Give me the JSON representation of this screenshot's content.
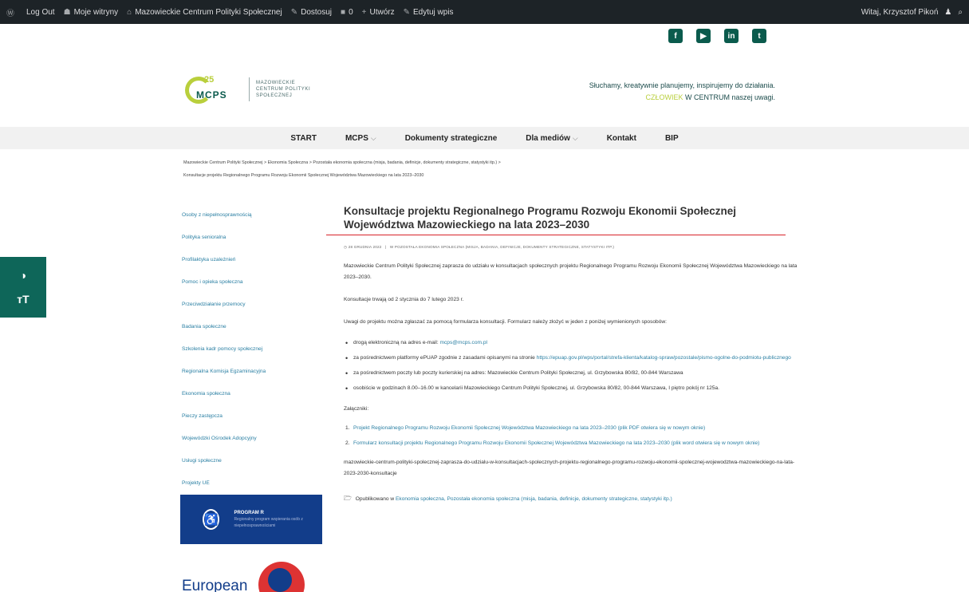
{
  "admin_bar": {
    "items": [
      {
        "icon": "wordpress-icon",
        "glyph": "Ⓦ",
        "label": ""
      },
      {
        "icon": "logout-icon",
        "glyph": "",
        "label": "Log Out"
      },
      {
        "icon": "network-icon",
        "glyph": "☗",
        "label": "Moje witryny"
      },
      {
        "icon": "home-icon",
        "glyph": "⌂",
        "label": "Mazowieckie Centrum Polityki Społecznej"
      },
      {
        "icon": "customize-icon",
        "glyph": "✎",
        "label": "Dostosuj"
      },
      {
        "icon": "comments-icon",
        "glyph": "■",
        "label": "0"
      },
      {
        "icon": "plus-icon",
        "glyph": "+",
        "label": "Utwórz"
      },
      {
        "icon": "edit-icon",
        "glyph": "✎",
        "label": "Edytuj wpis"
      }
    ],
    "greeting": "Witaj, Krzysztof Pikoń",
    "user_glyph": "♟",
    "search_glyph": "⌕"
  },
  "social": [
    {
      "name": "facebook-icon",
      "glyph": "f"
    },
    {
      "name": "youtube-icon",
      "glyph": "▶"
    },
    {
      "name": "linkedin-icon",
      "glyph": "in"
    },
    {
      "name": "twitter-icon",
      "glyph": "t"
    }
  ],
  "logo": {
    "years": "25",
    "acronym": "MCPS",
    "line1": "MAZOWIECKIE",
    "line2": "CENTRUM POLITYKI",
    "line3": "SPOŁECZNEJ"
  },
  "tagline": {
    "line1": "Słuchamy, kreatywnie planujemy, inspirujemy do działania.",
    "line2_prefix": "",
    "line2_highlight": "CZŁOWIEK",
    "line2_suffix": " W CENTRUM naszej uwagi."
  },
  "nav": [
    {
      "label": "START",
      "dropdown": false
    },
    {
      "label": "MCPS",
      "dropdown": true
    },
    {
      "label": "Dokumenty strategiczne",
      "dropdown": false
    },
    {
      "label": "Dla mediów",
      "dropdown": true
    },
    {
      "label": "Kontakt",
      "dropdown": false
    },
    {
      "label": "BIP",
      "dropdown": false
    }
  ],
  "breadcrumb": {
    "line1": "Mazowieckie Centrum Polityki Społecznej  >  Ekonomia Społeczna  >  Pozostała ekonomia społeczna (misja, badania, definicje, dokumenty strategiczne, statystyki itp.)  >",
    "line2": "Konsultacje projektu Regionalnego Programu Rozwoju Ekonomii Społecznej Województwa Mazowieckiego na lata 2023–2030"
  },
  "sidebar": [
    "Osoby z niepełnosprawnością",
    "Polityka senioralna",
    "Profilaktyka uzależnień",
    "Pomoc i opieka społeczna",
    "Przeciwdziałanie przemocy",
    "Badania społeczne",
    "Szkolenia kadr pomocy społecznej",
    "Regionalna Komisja Egzaminacyjna",
    "Ekonomia społeczna",
    "Pieczy zastępcza",
    "Wojewódzki Ośrodek Adopcyjny",
    "Usługi społeczne",
    "Projekty UE"
  ],
  "banner1": {
    "title": "PROGRAM R",
    "subtitle": "Regionalny program wspierania osób z niepełnosprawnościami"
  },
  "banner2": {
    "text": "European"
  },
  "a11y": {
    "contrast_glyph": "◑",
    "fontsize_glyph": "ᴛT"
  },
  "article": {
    "title": "Konsultacje projektu Regionalnego Programu Rozwoju Ekonomii Społecznej Województwa Mazowieckiego na lata 2023–2030",
    "date": "28 GRUDNIA 2022",
    "category": "W POZOSTAŁA EKONOMIA SPOŁECZNA (MISJA, BADANIA, DEFINICJE, DOKUMENTY STRATEGICZNE, STATYSTYKI ITP.)",
    "intro": "Mazowieckie Centrum Polityki Społecznej zaprasza do udziału w konsultacjach społecznych projektu Regionalnego Programu Rozwoju Ekonomii Społecznej Województwa Mazowieckiego na lata 2023–2030.",
    "duration": "Konsultacje trwają od 2 stycznia do 7 lutego 2023 r.",
    "howto": "Uwagi do projektu można zgłaszać za pomocą formularza konsultacji. Formularz należy złożyć w jeden z poniżej wymienionych sposobów:",
    "ways": [
      {
        "text": "drogą elektroniczną na adres e-mail: ",
        "link": "mcps@mcps.com.pl",
        "after": ""
      },
      {
        "text": "za pośrednictwem platformy ePUAP zgodnie z zasadami opisanymi na stronie ",
        "link": "https://epuap.gov.pl/wps/portal/strefa-klienta/katalog-spraw/pozostale/pismo-ogolne-do-podmiotu-publicznego",
        "after": ""
      },
      {
        "text": "za pośrednictwem poczty lub poczty kurierskiej na adres: Mazowieckie Centrum Polityki Społecznej, ul. Grzybowska 80/82, 00-844 Warszawa",
        "link": "",
        "after": ""
      },
      {
        "text": "osobiście w godzinach 8.00–16.00 w kancelarii Mazowieckiego Centrum Polityki Społecznej, ul. Grzybowska 80/82, 00-844 Warszawa, I piętro pokój nr 125a.",
        "link": "",
        "after": ""
      }
    ],
    "attachments_label": "Załączniki:",
    "attachments": [
      "Projekt Regionalnego Programu Rozwoju Ekonomii Społecznej Województwa Mazowieckiego na lata 2023–2030 (plik PDF otwiera się w nowym oknie)",
      "Formularz konsultacji projektu Regionalnego Programu Rozwoju Ekonomii Społecznej Województwa Mazowieckiego na lata 2023–2030 (plik word otwiera się w nowym oknie)"
    ],
    "slug": "mazowieckie-centrum-polityki-spolecznej-zaprasza-do-udzialu-w-konsultacjach-spolecznych-projektu-regionalnego-programu-rozwoju-ekonomii-spolecznej-wojewodztwa-mazowieckiego-na-lata-2023-2030-konsultacje",
    "published_label": "Opublikowano w",
    "published_in": "Ekonomia społeczna, Pozostała ekonomia społeczna (misja, badania, definicje, dokumenty strategiczne, statystyki itp.)"
  }
}
